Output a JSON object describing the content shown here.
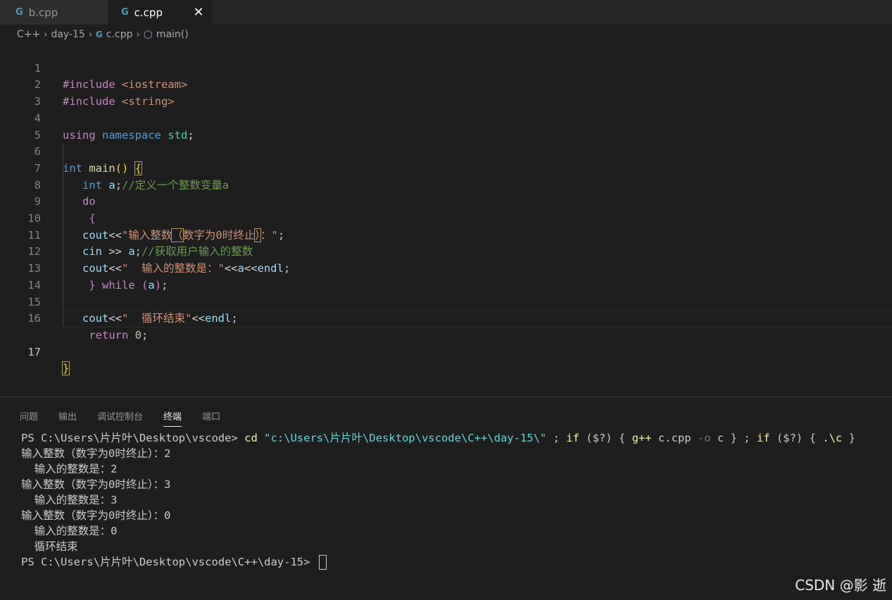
{
  "tabs": [
    {
      "icon": "G",
      "label": "b.cpp"
    },
    {
      "icon": "G",
      "label": "c.cpp",
      "close": "✕"
    }
  ],
  "breadcrumb": {
    "root": "C++",
    "folder": "day-15",
    "file": "c.cpp",
    "symbol": "main()"
  },
  "editor": {
    "line_numbers": [
      "1",
      "2",
      "3",
      "4",
      "5",
      "6",
      "7",
      "8",
      "9",
      "10",
      "11",
      "12",
      "13",
      "14",
      "15",
      "16",
      "17"
    ],
    "current_line": "17",
    "code": {
      "l1_directive": "#include",
      "l1_header": " <iostream>",
      "l2_directive": "#include",
      "l2_header": " <string>",
      "l4_using": "using",
      "l4_namespace": "namespace",
      "l4_std": "std",
      "l4_semi": ";",
      "l6_int": "int",
      "l6_main": "main",
      "l6_parens": "()",
      "l6_brace": "{",
      "l7_int": "int",
      "l7_a": "a",
      "l7_semi": ";",
      "l7_comment": "//定义一个整数变量a",
      "l8_do": "do",
      "l9_brace": "{",
      "l10_cout": "cout",
      "l10_op": "<<",
      "l10_str1": "\"输入整数",
      "l10_str2": "（",
      "l10_str3": "数字为0时终止",
      "l10_str4": "）",
      "l10_str5": "：\"",
      "l10_semi": ";",
      "l11_cin": "cin",
      "l11_op": " >> ",
      "l11_a": "a",
      "l11_semi": ";",
      "l11_comment": "//获取用户输入的整数",
      "l12_cout": "cout",
      "l12_op1": "<<",
      "l12_str": "\"  输入的整数是：\"",
      "l12_op2": "<<",
      "l12_a": "a",
      "l12_op3": "<<",
      "l12_endl": "endl",
      "l12_semi": ";",
      "l13_brace": "}",
      "l13_while": "while",
      "l13_lp": "(",
      "l13_a": "a",
      "l13_rp": ")",
      "l13_semi": ";",
      "l15_cout": "cout",
      "l15_op1": "<<",
      "l15_str": "\"  循环结束\"",
      "l15_op2": "<<",
      "l15_endl": "endl",
      "l15_semi": ";",
      "l16_return": "return",
      "l16_zero": "0",
      "l16_semi": ";",
      "l17_brace": "}"
    }
  },
  "panel": {
    "tabs": [
      "问题",
      "输出",
      "调试控制台",
      "终端",
      "端口"
    ],
    "active_tab": "终端"
  },
  "terminal": {
    "cmd_prompt": "PS C:\\Users\\片片叶\\Desktop\\vscode> ",
    "cmd_cd": "cd",
    "cmd_path": "\"c:\\Users\\片片叶\\Desktop\\vscode\\C++\\day-15\\\"",
    "cmd_sep1": " ; ",
    "cmd_if1": "if",
    "cmd_cond1": " ($?) { ",
    "cmd_gpp": "g++",
    "cmd_args": " c.cpp ",
    "cmd_flag": "-o",
    "cmd_out": " c } ; ",
    "cmd_if2": "if",
    "cmd_cond2": " ($?) { ",
    "cmd_run": ".\\c",
    "cmd_end": " }",
    "output_lines": [
      "输入整数（数字为0时终止）：2",
      "  输入的整数是：2",
      "输入整数（数字为0时终止）：3",
      "  输入的整数是：3",
      "输入整数（数字为0时终止）：0",
      "  输入的整数是：0",
      "  循环结束"
    ],
    "final_prompt": "PS C:\\Users\\片片叶\\Desktop\\vscode\\C++\\day-15> "
  },
  "watermark": "CSDN @影 逝"
}
